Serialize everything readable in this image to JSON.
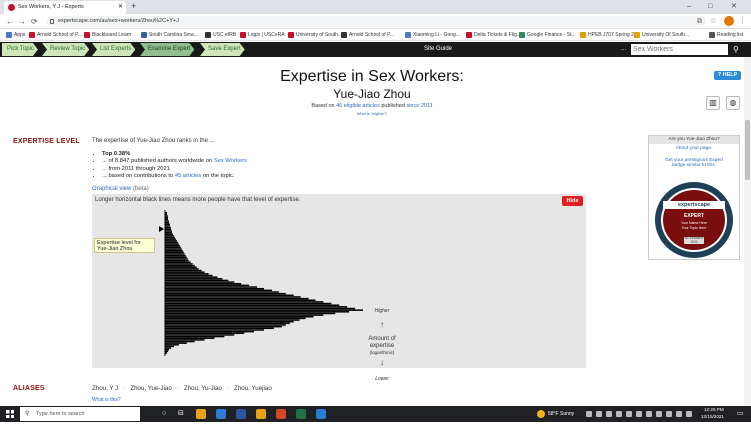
{
  "browser": {
    "tab_title": "Sex Workers, Y J - Experts",
    "new_tab": "+",
    "url": "expertscape.com/au/sex+workers/Zhou%2C+Y+J",
    "window_controls": [
      "–",
      "□",
      "✕"
    ],
    "bookmarks": [
      {
        "label": "Apps",
        "color": "#4a7ac8"
      },
      {
        "label": "Arnold School of P...",
        "color": "#c8102e"
      },
      {
        "label": "Blackboard Learn",
        "color": "#c8102e"
      },
      {
        "label": "South Carolina Sma...",
        "color": "#3a5fa0"
      },
      {
        "label": "USC eIRB",
        "color": "#333333"
      },
      {
        "label": "Login | USCeRA",
        "color": "#c8102e"
      },
      {
        "label": "University of South...",
        "color": "#c8102e"
      },
      {
        "label": "Arnold School of P...",
        "color": "#333333"
      },
      {
        "label": "Xiaoming Li - Goog...",
        "color": "#4a7ac8"
      },
      {
        "label": "Delta Tickets & Flig...",
        "color": "#c8102e"
      },
      {
        "label": "Google Finance - St...",
        "color": "#2e8b57"
      },
      {
        "label": "HPEB J707 Spring 2...",
        "color": "#e0a000"
      },
      {
        "label": "University Of South...",
        "color": "#e0a000"
      },
      {
        "label": "Reading list",
        "color": "#555555"
      }
    ]
  },
  "site_nav": {
    "steps": [
      "Pick Topic",
      "Review Topic",
      "List Experts",
      "Examine Expert",
      "Save Expert"
    ],
    "active_step": "Examine Expert",
    "site_guide": "Site Guide",
    "ellipsis": "...",
    "search_placeholder": "Sex Workers",
    "search_icon": "magnifier-icon"
  },
  "header": {
    "title": "Expertise in Sex Workers:",
    "expert_name": "Yue-Jiao Zhou",
    "based_on_prefix": "Based on",
    "eligible_articles": "46 eligible articles",
    "published": "published",
    "since": "since 2011",
    "what_eligible": "What is \"eligible\"?",
    "help_label": "HELP"
  },
  "expertise": {
    "section_label": "EXPERTISE LEVEL",
    "intro": "The expertise of Yue-Jiao Zhou ranks in the ...",
    "facts": [
      {
        "parts": [
          {
            "t": "Top 0.38%",
            "bold": true
          }
        ]
      },
      {
        "parts": [
          {
            "t": "... of 8,847 published authors worldwide on "
          },
          {
            "t": "Sex Workers",
            "link": true
          }
        ]
      },
      {
        "parts": [
          {
            "t": "... from 2011 through 2021"
          }
        ]
      },
      {
        "parts": [
          {
            "t": "... based on contributions to "
          },
          {
            "t": "45 articles",
            "link": true
          },
          {
            "t": " on the topic."
          }
        ]
      }
    ],
    "graphical_view": "Graphical view",
    "beta": "(beta)",
    "chart_note": "Longer horizontal black lines means more people have that level of expertise.",
    "hide_button": "Hide",
    "expert_level_label": "Expertise level for Yue-Jiao Zhou",
    "higher": "Higher",
    "up_arrow": "↑",
    "amount_label": "Amount of",
    "expertise_label": "expertise",
    "log_label": "(logarithmic)",
    "down_arrow": "↓",
    "lower": "Lower"
  },
  "sidebar": {
    "header": "Are you Yue-Jiao Zhou?",
    "about": "About your page.",
    "get_badge": "Get your prestigious Expert badge similar to this:",
    "badge_brand": "expertscape",
    "badge_expert": "EXPERT",
    "badge_name": "Your Name Here",
    "badge_topic": "Your Topic Here",
    "badge_year_1": "NOVEMBER",
    "badge_year_2": "2020"
  },
  "aliases": {
    "section_label": "ALIASES",
    "names": [
      "Zhou, Y J",
      "Zhou, Yue-Jiao",
      "Zhou, Yu-Jiao",
      "Zhou, Yuejiao"
    ],
    "what_this": "What is this?"
  },
  "taskbar": {
    "search_placeholder": "Type here to search",
    "weather": "58°F Sunny",
    "time": "12:26 PM",
    "date": "12/15/2021"
  },
  "chart_data": {
    "type": "bar",
    "orientation": "horizontal",
    "xlabel": "",
    "ylabel": "Amount of expertise (logarithmic)",
    "axis_direction": "Higher at top, Lower at bottom",
    "expert_marker_fraction_from_top": 0.12,
    "values": [
      2,
      2,
      3,
      3,
      3,
      4,
      4,
      5,
      5,
      6,
      6,
      7,
      7,
      8,
      9,
      10,
      11,
      12,
      13,
      14,
      15,
      16,
      17,
      18,
      19,
      20,
      21,
      22,
      23,
      24,
      26,
      28,
      30,
      32,
      34,
      37,
      40,
      44,
      48,
      53,
      58,
      64,
      70,
      77,
      85,
      93,
      100,
      108,
      115,
      122,
      130,
      137,
      145,
      152,
      160,
      168,
      176,
      184,
      192,
      200,
      186,
      172,
      160,
      150,
      142,
      136,
      130,
      126,
      122,
      118,
      110,
      100,
      90,
      80,
      70,
      60,
      50,
      40,
      30,
      22,
      14,
      9,
      6,
      4,
      3,
      2
    ]
  }
}
